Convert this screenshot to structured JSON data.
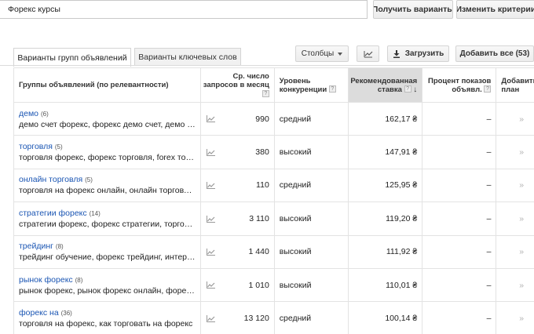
{
  "search": {
    "value": "Форекс курсы"
  },
  "buttons": {
    "get": "Получить варианты",
    "change": "Изменить критерии п"
  },
  "tabs": [
    {
      "label": "Варианты групп объявлений",
      "active": true
    },
    {
      "label": "Варианты ключевых слов",
      "active": false
    }
  ],
  "toolbar": {
    "columns": "Столбцы",
    "download": "Загрузить",
    "add_all": "Добавить все (53)"
  },
  "table": {
    "headers": {
      "group": "Группы объявлений (по релевантности)",
      "volume_1": "Ср. число",
      "volume_2": "запросов в месяц",
      "competition_1": "Уровень",
      "competition_2": "конкуренции",
      "bid_1": "Рекомендованная",
      "bid_2": "ставка",
      "share_1": "Процент показов",
      "share_2": "объявл.",
      "add_1": "Добавить в",
      "add_2": "план",
      "help": "?"
    },
    "rows": [
      {
        "name": "демо",
        "count": "(6)",
        "keywords": "демо счет форекс, форекс демо счет, демо счет на форекс",
        "volume": "990",
        "competition": "средний",
        "bid": "162,17 ₴",
        "share": "–"
      },
      {
        "name": "торговля",
        "count": "(5)",
        "keywords": "торговля форекс, форекс торговля, forex торговля",
        "volume": "380",
        "competition": "высокий",
        "bid": "147,91 ₴",
        "share": "–"
      },
      {
        "name": "онлайн торговля",
        "count": "(5)",
        "keywords": "торговля на форекс онлайн, онлайн торговля форекс",
        "volume": "110",
        "competition": "средний",
        "bid": "125,95 ₴",
        "share": "–"
      },
      {
        "name": "стратегии форекс",
        "count": "(14)",
        "keywords": "стратегии форекс, форекс стратегии, торговые стратегии",
        "volume": "3 110",
        "competition": "высокий",
        "bid": "119,20 ₴",
        "share": "–"
      },
      {
        "name": "трейдинг",
        "count": "(8)",
        "keywords": "трейдинг обучение, форекс трейдинг, интернет трейдинг",
        "volume": "1 440",
        "competition": "высокий",
        "bid": "111,92 ₴",
        "share": "–"
      },
      {
        "name": "рынок форекс",
        "count": "(8)",
        "keywords": "рынок форекс, рынок форекс онлайн, форекс рынок",
        "volume": "1 010",
        "competition": "высокий",
        "bid": "110,01 ₴",
        "share": "–"
      },
      {
        "name": "форекс на",
        "count": "(36)",
        "keywords": "торговля на форекс, как торговать на форекс",
        "volume": "13 120",
        "competition": "средний",
        "bid": "100,14 ₴",
        "share": "–"
      }
    ],
    "add_glyph": "»"
  },
  "icons": {
    "trend": "trend-chart-icon",
    "download": "download-icon",
    "chart": "line-chart-icon"
  }
}
